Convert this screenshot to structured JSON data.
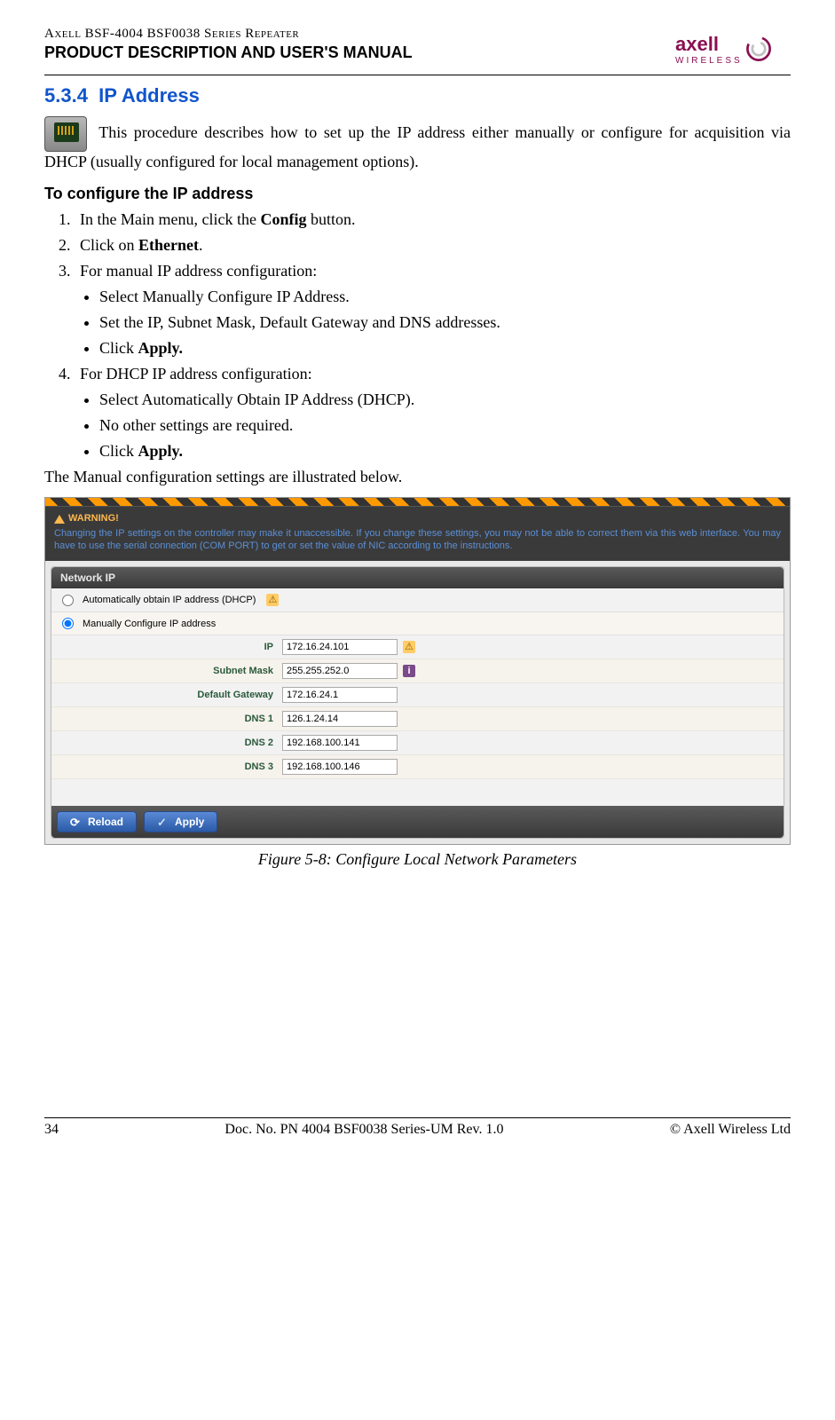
{
  "header": {
    "doc_line1": "Axell BSF-4004 BSF0038 Series Repeater",
    "doc_line2": "PRODUCT DESCRIPTION AND USER'S MANUAL",
    "logo_main": "axell",
    "logo_sub": "WIRELESS"
  },
  "section": {
    "number": "5.3.4",
    "title": "IP Address"
  },
  "intro": "This procedure describes how to set up the IP address either manually or configure for acquisition via DHCP (usually configured for local management options).",
  "subheading": "To configure the IP address",
  "steps": [
    {
      "text_pre": "In the Main menu, click the ",
      "bold": "Config",
      "text_post": " button."
    },
    {
      "text_pre": "Click on ",
      "bold": "Ethernet",
      "text_post": "."
    },
    {
      "text_pre": "For manual IP address configuration:",
      "sub": [
        "Select Manually Configure IP Address.",
        "Set the IP, Subnet Mask, Default Gateway and DNS addresses.",
        {
          "pre": "Click ",
          "bold": "Apply."
        }
      ]
    },
    {
      "text_pre": "For DHCP IP address configuration:",
      "sub": [
        "Select Automatically Obtain IP Address (DHCP).",
        "No other settings are required.",
        {
          "pre": "Click ",
          "bold": "Apply."
        }
      ]
    }
  ],
  "post_list": "The Manual configuration settings are illustrated below.",
  "screenshot": {
    "warning_title": "WARNING!",
    "warning_text": "Changing the IP settings on the controller may make it unaccessible. If you change these settings, you may not be able to correct them via this web interface. You may have to use the serial connection (COM PORT) to get or set the value of NIC according to the instructions.",
    "panel_title": "Network IP",
    "radio_dhcp": "Automatically obtain IP address (DHCP)",
    "radio_manual": "Manually Configure IP address",
    "fields": [
      {
        "label": "IP",
        "value": "172.16.24.101",
        "icon": "warn"
      },
      {
        "label": "Subnet Mask",
        "value": "255.255.252.0",
        "icon": "info"
      },
      {
        "label": "Default Gateway",
        "value": "172.16.24.1",
        "icon": ""
      },
      {
        "label": "DNS 1",
        "value": "126.1.24.14",
        "icon": ""
      },
      {
        "label": "DNS 2",
        "value": "192.168.100.141",
        "icon": ""
      },
      {
        "label": "DNS 3",
        "value": "192.168.100.146",
        "icon": ""
      }
    ],
    "btn_reload": "Reload",
    "btn_apply": "Apply"
  },
  "figure_caption": "Figure 5-8:  Configure Local Network Parameters",
  "footer": {
    "page": "34",
    "doc": "Doc. No. PN 4004 BSF0038 Series-UM Rev. 1.0",
    "copyright": "© Axell Wireless Ltd"
  }
}
